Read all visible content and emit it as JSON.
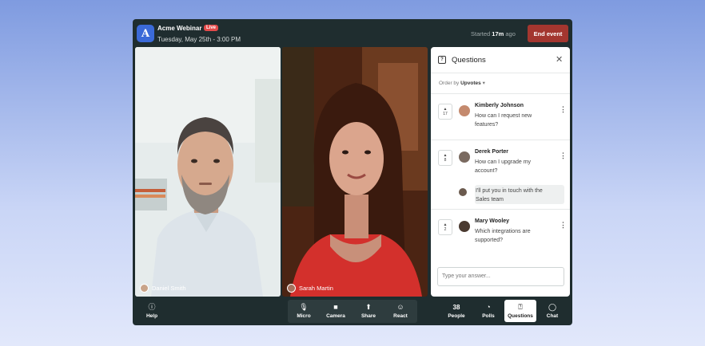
{
  "header": {
    "logo_letter": "A",
    "title": "Acme Webinar",
    "live_badge": "Live",
    "date": "Tuesday, May 25th - 3:00 PM",
    "started_prefix": "Started",
    "started_time": "17m",
    "started_suffix": "ago",
    "end_button": "End event"
  },
  "videos": [
    {
      "name": "Daniel Smith"
    },
    {
      "name": "Sarah Martin"
    }
  ],
  "questions_panel": {
    "icon": "question-icon",
    "title": "Questions",
    "close_icon": "close-icon",
    "order_label": "Order by",
    "order_value": "Upvotes",
    "items": [
      {
        "votes": "17",
        "name": "Kimberly Johnson",
        "text": "How can I request new features?"
      },
      {
        "votes": "8",
        "name": "Derek Porter",
        "text": "How can I upgrade my account?",
        "reply": "I'll put you in touch with the Sales team"
      },
      {
        "votes": "2",
        "name": "Mary Wooley",
        "text": "Which integrations are supported?"
      }
    ],
    "answer_placeholder": "Type your answer..."
  },
  "controls": {
    "help": "Help",
    "micro": "Micro",
    "camera": "Camera",
    "share": "Share",
    "react": "React",
    "people_count": "38",
    "people": "People",
    "polls": "Polls",
    "questions": "Questions",
    "chat": "Chat"
  },
  "colors": {
    "app_bg": "#1f2d2f",
    "end_button": "#a3362f",
    "live_badge": "#e44b4b",
    "logo": "#3b6ad8"
  }
}
